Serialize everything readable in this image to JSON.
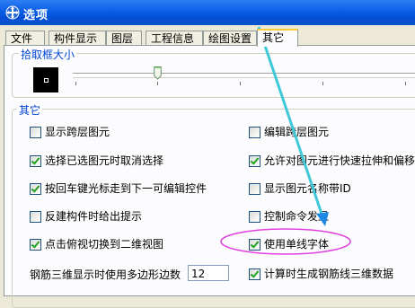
{
  "window": {
    "title": "选项"
  },
  "tabs": [
    {
      "label": "文件",
      "active": false
    },
    {
      "label": "构件显示",
      "active": false
    },
    {
      "label": "图层",
      "active": false
    },
    {
      "label": "工程信息",
      "active": false
    },
    {
      "label": "绘图设置",
      "active": false
    },
    {
      "label": "其它",
      "active": true
    }
  ],
  "pick_box": {
    "label": "拾取框大小",
    "slider_level": 0.3
  },
  "other_group": {
    "label": "其它",
    "left_options": [
      {
        "label": "显示跨层图元",
        "checked": false
      },
      {
        "label": "选择已选图元时取消选择",
        "checked": true
      },
      {
        "label": "按回车键光标走到下一可编辑控件",
        "checked": true
      },
      {
        "label": "反建构件时给出提示",
        "checked": false
      },
      {
        "label": "点击俯视切换到二维视图",
        "checked": true
      }
    ],
    "right_options": [
      {
        "label": "编辑跨层图元",
        "checked": false
      },
      {
        "label": "允许对图元进行快速拉伸和偏移",
        "checked": true
      },
      {
        "label": "显示图元名称带ID",
        "checked": false
      },
      {
        "label": "控制命令发显",
        "checked": false
      },
      {
        "label": "使用单线字体",
        "checked": true
      },
      {
        "label": "计算时生成钢筋线三维数据",
        "checked": true
      }
    ],
    "polygon_edges": {
      "label": "钢筋三维显示时使用多边形边数",
      "value": "12"
    }
  },
  "colors": {
    "annotation_arrow": "#3ec8d8",
    "annotation_ellipse": "#e040e0"
  }
}
